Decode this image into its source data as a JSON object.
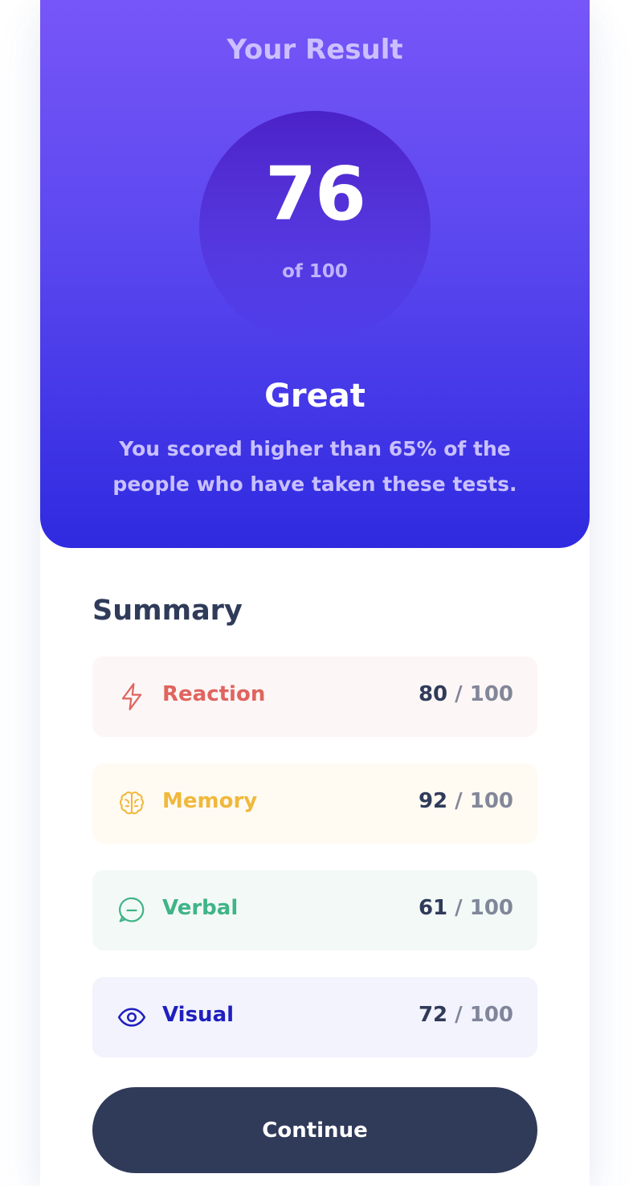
{
  "result": {
    "title": "Your Result",
    "score": "76",
    "score_of": "of 100",
    "grade": "Great",
    "description": "You scored higher than 65% of the people who have taken these tests."
  },
  "summary": {
    "title": "Summary",
    "items": [
      {
        "label": "Reaction",
        "score": "80",
        "max": " / 100",
        "icon": "lightning-icon",
        "color": "#e0645f",
        "bg": "#fdf6f6"
      },
      {
        "label": "Memory",
        "score": "92",
        "max": " / 100",
        "icon": "brain-icon",
        "color": "#f0b83c",
        "bg": "#fffbf3"
      },
      {
        "label": "Verbal",
        "score": "61",
        "max": " / 100",
        "icon": "chat-bubble-icon",
        "color": "#40b487",
        "bg": "#f3f9f7"
      },
      {
        "label": "Visual",
        "score": "72",
        "max": " / 100",
        "icon": "eye-icon",
        "color": "#1f1fbf",
        "bg": "#f2f3fd"
      }
    ]
  },
  "continue_label": "Continue",
  "colors": {
    "gradient_top": "#7756f8",
    "gradient_bottom": "#2f2ae0",
    "button": "#303b5a"
  }
}
